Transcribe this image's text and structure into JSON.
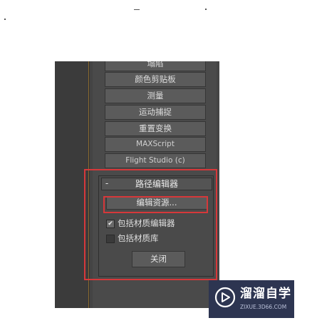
{
  "utility_buttons": [
    "塌陷",
    "颜色剪贴板",
    "测量",
    "运动捕捉",
    "重置变换",
    "MAXScript",
    "Flight Studio (c)"
  ],
  "rollout": {
    "toggle": "-",
    "title": "路径编辑器",
    "edit_button": "编辑资源...",
    "options": [
      {
        "label": "包括材质编辑器",
        "checked": true,
        "mark": "✔"
      },
      {
        "label": "包括材质库",
        "checked": false,
        "mark": ""
      }
    ],
    "close_button": "关闭"
  },
  "watermark": {
    "name": "溜溜自学",
    "url": "ZIXUE.3D66.COM"
  },
  "colors": {
    "highlight": "#d6383a",
    "panel": "#4a4a4a",
    "watermark_bg": "#2d3551"
  }
}
